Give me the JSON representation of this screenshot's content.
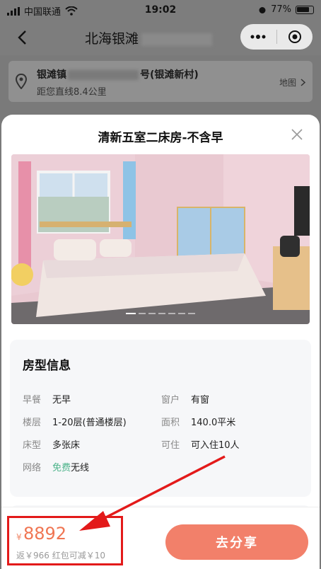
{
  "status_bar": {
    "carrier": "中国联通",
    "time": "19:02",
    "battery": "77%"
  },
  "nav": {
    "title": "北海银滩"
  },
  "address": {
    "name": "银滩镇",
    "name_suffix": "号(银滩新村)",
    "distance": "距您直线8.4公里",
    "map_label": "地图"
  },
  "sheet": {
    "title": "清新五室二床房-不含早"
  },
  "photo": {
    "slide_count": 7,
    "active_slide": 1
  },
  "room_info": {
    "title": "房型信息",
    "items": [
      {
        "key": "早餐",
        "value": "无早"
      },
      {
        "key": "窗户",
        "value": "有窗"
      },
      {
        "key": "楼层",
        "value": "1-20层(普通楼层)"
      },
      {
        "key": "面积",
        "value": "140.0平米"
      },
      {
        "key": "床型",
        "value": "多张床"
      },
      {
        "key": "可住",
        "value": "可入住10人"
      },
      {
        "key": "网络",
        "value_highlight": "免费",
        "value": "无线"
      }
    ]
  },
  "price": {
    "currency": "¥",
    "amount": "8892",
    "rebate": "返￥966  红包可减￥10"
  },
  "share_button": "去分享",
  "colors": {
    "accent": "#f2806a",
    "price": "#f07552",
    "free": "#4cb38a",
    "annotation": "#e31a1a"
  }
}
